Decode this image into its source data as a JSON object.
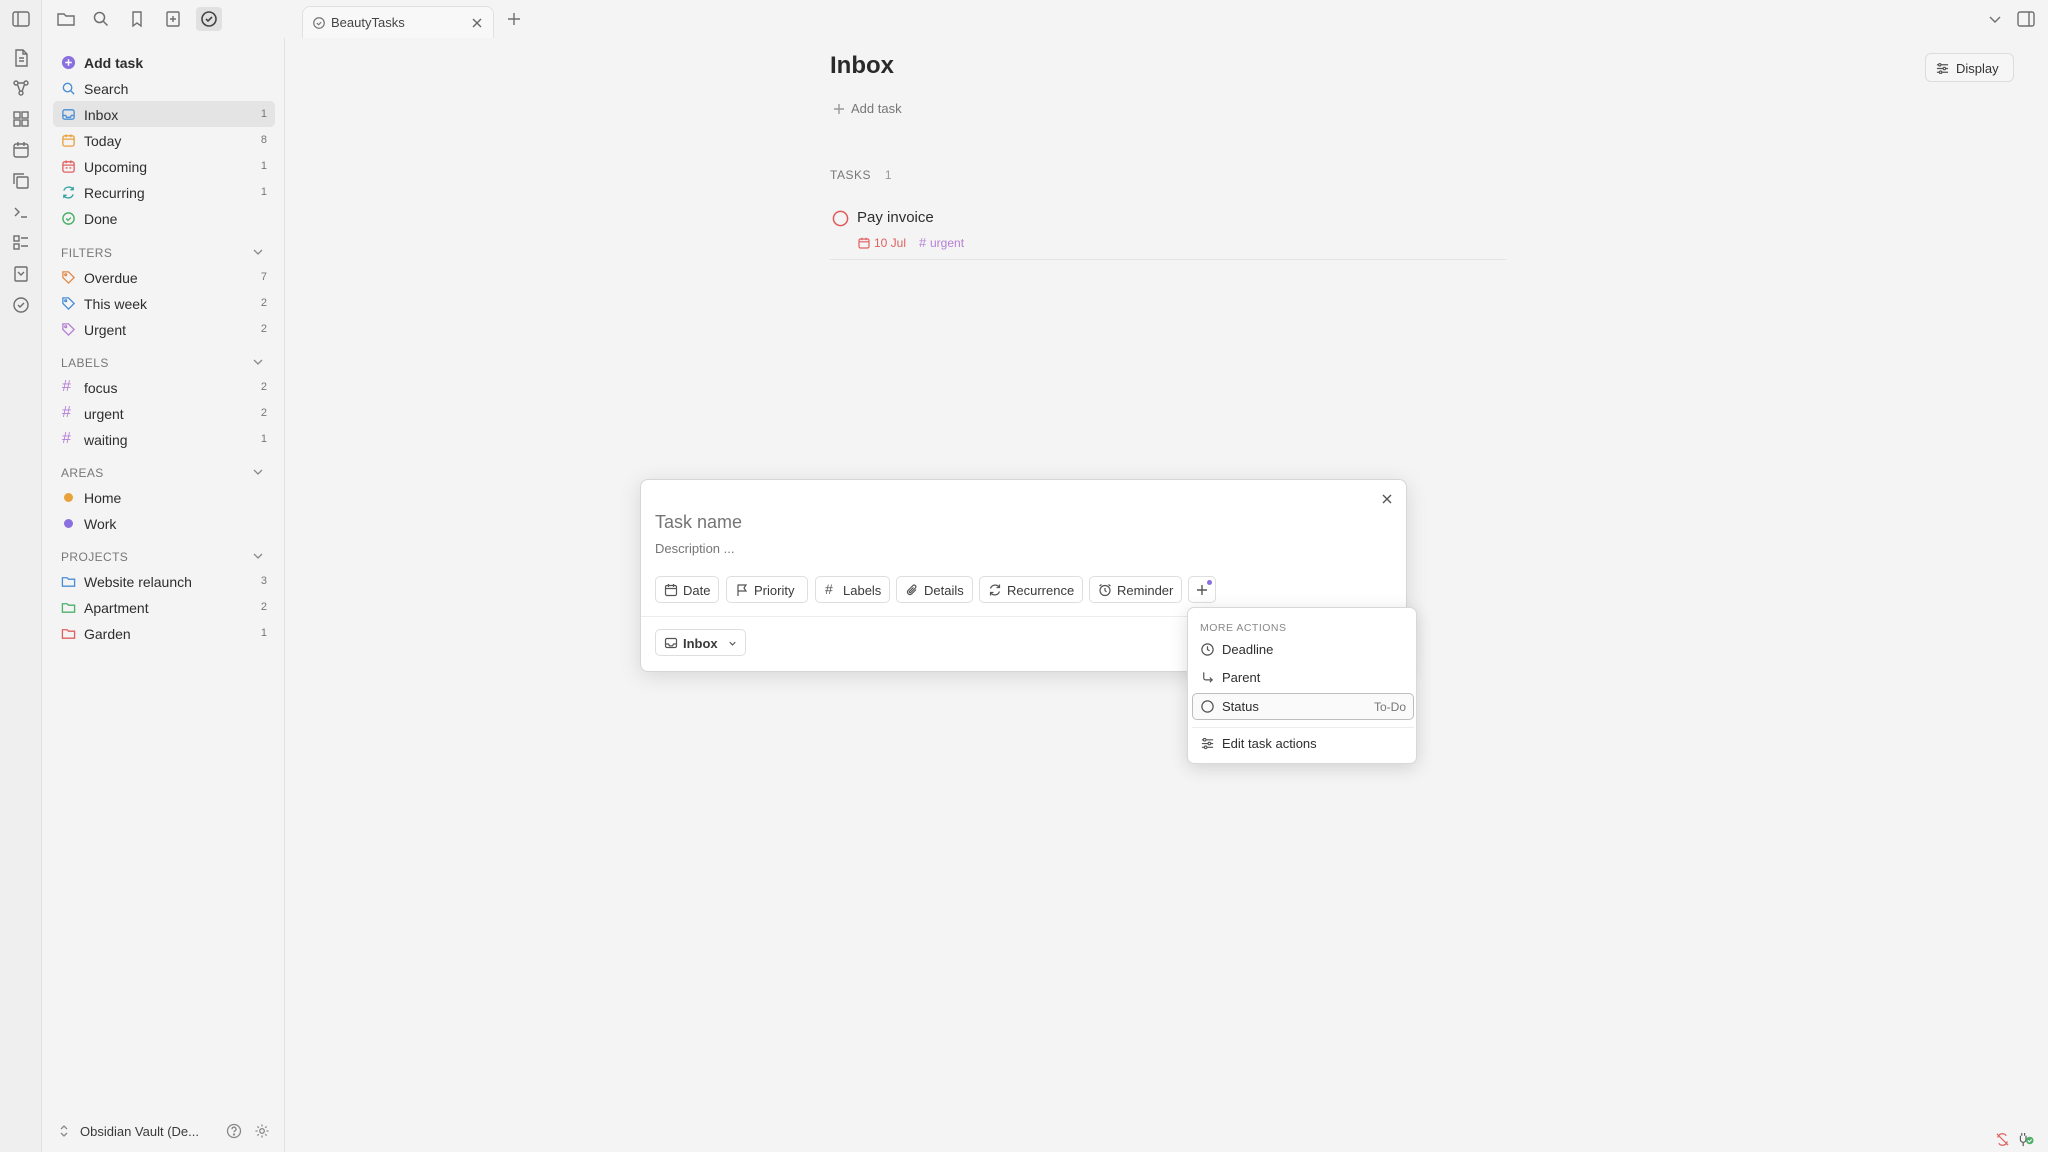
{
  "tab": {
    "title": "BeautyTasks"
  },
  "sidebar": {
    "main_items": [
      {
        "label": "Add task",
        "count": ""
      },
      {
        "label": "Search",
        "count": ""
      },
      {
        "label": "Inbox",
        "count": "1"
      },
      {
        "label": "Today",
        "count": "8"
      },
      {
        "label": "Upcoming",
        "count": "1"
      },
      {
        "label": "Recurring",
        "count": "1"
      },
      {
        "label": "Done",
        "count": ""
      }
    ],
    "filters": {
      "title": "FILTERS",
      "items": [
        {
          "label": "Overdue",
          "count": "7"
        },
        {
          "label": "This week",
          "count": "2"
        },
        {
          "label": "Urgent",
          "count": "2"
        }
      ]
    },
    "labels": {
      "title": "LABELS",
      "items": [
        {
          "label": "focus",
          "count": "2"
        },
        {
          "label": "urgent",
          "count": "2"
        },
        {
          "label": "waiting",
          "count": "1"
        }
      ]
    },
    "areas": {
      "title": "AREAS",
      "items": [
        {
          "label": "Home",
          "color": "#e8a23c"
        },
        {
          "label": "Work",
          "color": "#8a6fe0"
        }
      ]
    },
    "projects": {
      "title": "PROJECTS",
      "items": [
        {
          "label": "Website relaunch",
          "count": "3",
          "color": "#4a8ed6"
        },
        {
          "label": "Apartment",
          "count": "2",
          "color": "#4caf6a"
        },
        {
          "label": "Garden",
          "count": "1",
          "color": "#e06060"
        }
      ]
    },
    "vault": {
      "name": "Obsidian Vault (De..."
    }
  },
  "main": {
    "title": "Inbox",
    "add_task_label": "Add task",
    "display_label": "Display",
    "tasks_header": "TASKS",
    "tasks_count": "1",
    "tasks": [
      {
        "name": "Pay invoice",
        "date": "10 Jul",
        "label": "urgent"
      }
    ]
  },
  "modal": {
    "task_name_placeholder": "Task name",
    "description_placeholder": "Description ...",
    "chips": [
      "Date",
      "Priority",
      "Labels",
      "Details",
      "Recurrence",
      "Reminder"
    ],
    "project_selector": "Inbox"
  },
  "more_menu": {
    "header": "MORE ACTIONS",
    "items": [
      {
        "label": "Deadline",
        "value": ""
      },
      {
        "label": "Parent",
        "value": ""
      },
      {
        "label": "Status",
        "value": "To-Do"
      },
      {
        "label": "Edit task actions",
        "value": ""
      }
    ]
  },
  "colors": {
    "accent": "#8a6fe0",
    "inbox": "#4a8ed6",
    "today": "#e8a23c",
    "upcoming": "#e06060",
    "recurring": "#36a3a3",
    "done": "#4caf6a",
    "label": "#b57fd6",
    "task_circle": "#e05a5a"
  }
}
